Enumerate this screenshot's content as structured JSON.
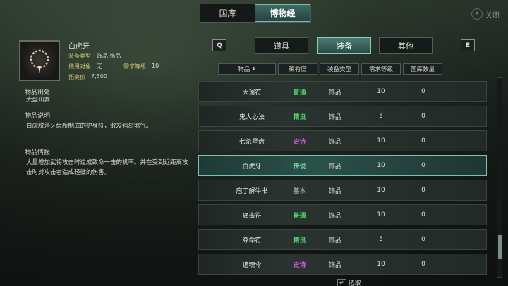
{
  "top_tabs": [
    {
      "label": "国库",
      "active": false
    },
    {
      "label": "博物经",
      "active": true
    }
  ],
  "top_right": {
    "key": "X",
    "label": "关闭"
  },
  "item": {
    "name": "白虎牙",
    "fields": [
      {
        "label": "装备类型",
        "value": "饰品   饰品"
      },
      {
        "label": "使用对象",
        "value": "无",
        "label2": "需求等级",
        "value2": "10"
      },
      {
        "label": "拓卖价",
        "value": "7,500"
      }
    ],
    "origin_title": "物品出处",
    "origin": "大型山寨",
    "desc_title": "物品说明",
    "desc": "白虎脱落牙齿所制成的护身符，散发强烈煞气。",
    "info_title": "物品情报",
    "info": "大量增加武将攻击时造成致命一击的机率。并在受到近距离攻击时对攻击者造成轻微的伤害。"
  },
  "categories": {
    "left_key": "Q",
    "right_key": "E",
    "tabs": [
      {
        "label": "道具",
        "active": false
      },
      {
        "label": "装备",
        "active": true
      },
      {
        "label": "其他",
        "active": false
      }
    ]
  },
  "headers": [
    "物品",
    "稀有度",
    "装备类型",
    "需求等级",
    "国库数量"
  ],
  "rarity_colors": {
    "普通": "#4fd06a",
    "精良": "#4fd06a",
    "史诗": "#c85ad6",
    "传说": "#79d6a0",
    "基本": "#9aa09c"
  },
  "rows": [
    {
      "name": "大運符",
      "rarity": "普通",
      "type": "饰品",
      "req": "10",
      "count": "0",
      "selected": false
    },
    {
      "name": "鬼人心法",
      "rarity": "精良",
      "type": "饰品",
      "req": "5",
      "count": "0",
      "selected": false
    },
    {
      "name": "七杀星盘",
      "rarity": "史诗",
      "type": "饰品",
      "req": "10",
      "count": "0",
      "selected": false
    },
    {
      "name": "白虎牙",
      "rarity": "传说",
      "type": "饰品",
      "req": "10",
      "count": "0",
      "selected": true
    },
    {
      "name": "庖丁解牛书",
      "rarity": "基本",
      "type": "饰品",
      "req": "10",
      "count": "0",
      "selected": false
    },
    {
      "name": "痛击符",
      "rarity": "普通",
      "type": "饰品",
      "req": "10",
      "count": "0",
      "selected": false
    },
    {
      "name": "夺命符",
      "rarity": "精良",
      "type": "饰品",
      "req": "5",
      "count": "0",
      "selected": false
    },
    {
      "name": "追魂令",
      "rarity": "史诗",
      "type": "饰品",
      "req": "10",
      "count": "0",
      "selected": false
    }
  ],
  "footer": {
    "key": "↵",
    "label": "选取"
  }
}
